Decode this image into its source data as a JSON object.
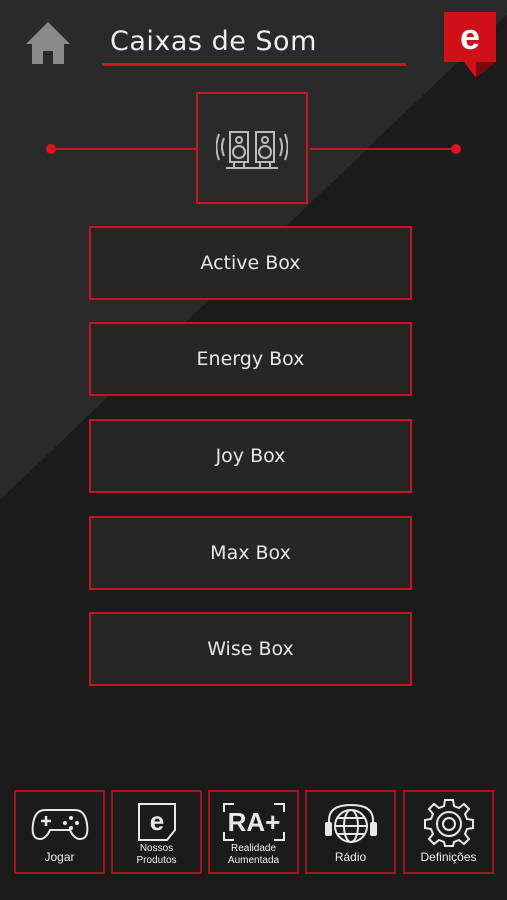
{
  "header": {
    "title": "Caixas de Som",
    "logo_letter": "e",
    "home_icon": "home-icon"
  },
  "category": {
    "icon": "speakers-icon"
  },
  "products": [
    {
      "label": "Active Box"
    },
    {
      "label": "Energy Box"
    },
    {
      "label": "Joy Box"
    },
    {
      "label": "Max Box"
    },
    {
      "label": "Wise Box"
    }
  ],
  "bottom_nav": [
    {
      "icon": "gamepad-icon",
      "label": "Jogar"
    },
    {
      "icon": "products-icon",
      "icon_letter": "e",
      "label_line1": "Nossos",
      "label_line2": "Produtos"
    },
    {
      "icon": "augmented-reality-icon",
      "icon_text": "RA+",
      "label_line1": "Realidade",
      "label_line2": "Aumentada"
    },
    {
      "icon": "radio-icon",
      "label": "Rádio"
    },
    {
      "icon": "settings-icon",
      "label": "Definições"
    }
  ],
  "colors": {
    "accent": "#c8161e",
    "background": "#1b1b1b",
    "button_fill": "#262626"
  }
}
